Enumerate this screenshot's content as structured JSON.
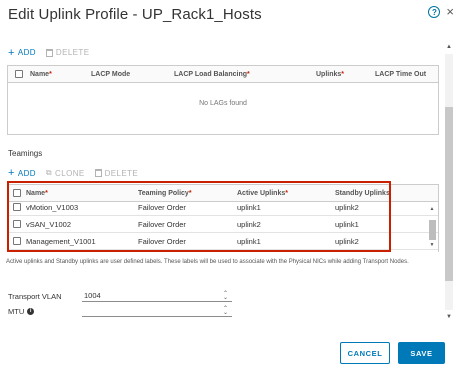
{
  "dialog": {
    "title": "Edit Uplink Profile - UP_Rack1_Hosts",
    "help_glyph": "?",
    "close_glyph": "×"
  },
  "lags": {
    "toolbar": {
      "add_label": "ADD",
      "delete_label": "DELETE"
    },
    "columns": [
      "Name",
      "LACP Mode",
      "LACP Load Balancing",
      "Uplinks",
      "LACP Time Out"
    ],
    "required": [
      true,
      false,
      true,
      true,
      false
    ],
    "empty_message": "No LAGs found"
  },
  "teamings": {
    "section_title": "Teamings",
    "toolbar": {
      "add_label": "ADD",
      "clone_label": "CLONE",
      "delete_label": "DELETE"
    },
    "columns": [
      "Name",
      "Teaming Policy",
      "Active Uplinks",
      "Standby Uplinks"
    ],
    "required": [
      true,
      true,
      true,
      false
    ],
    "rows": [
      {
        "name": "vMotion_V1003",
        "policy": "Failover Order",
        "active": "uplink1",
        "standby": "uplink2"
      },
      {
        "name": "vSAN_V1002",
        "policy": "Failover Order",
        "active": "uplink2",
        "standby": "uplink1"
      },
      {
        "name": "Management_V1001",
        "policy": "Failover Order",
        "active": "uplink1",
        "standby": "uplink2"
      }
    ]
  },
  "note": "Active uplinks and Standby uplinks are user defined labels. These labels will be used to associate with the Physical NICs while adding Transport Nodes.",
  "form": {
    "transport_vlan": {
      "label": "Transport VLAN",
      "value": "1004"
    },
    "mtu": {
      "label": "MTU",
      "value": ""
    }
  },
  "buttons": {
    "cancel": "CANCEL",
    "save": "SAVE"
  },
  "colors": {
    "accent": "#0079b8",
    "highlight": "#c92100",
    "required": "#c92100"
  }
}
